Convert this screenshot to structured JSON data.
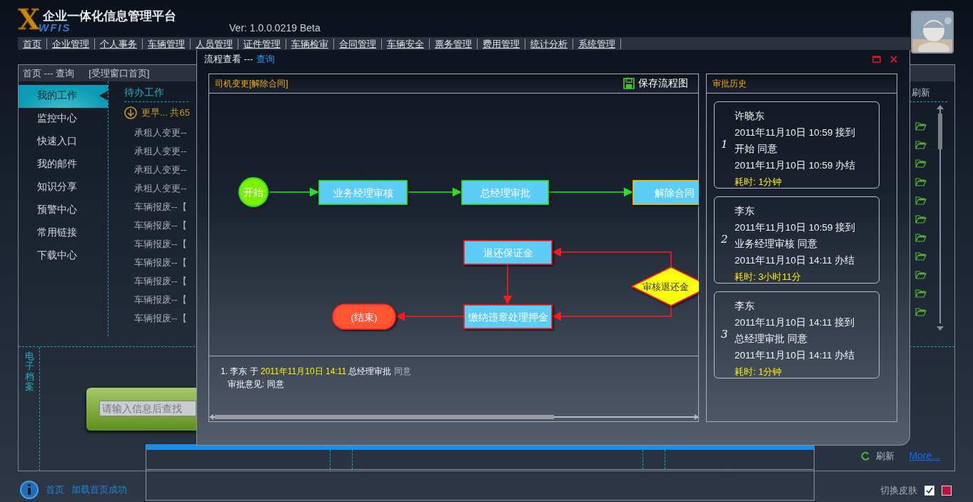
{
  "header": {
    "logo_letter": "X",
    "logo_text": "WFIS",
    "title": "企业一体化信息管理平台",
    "version": "Ver: 1.0.0.0219 Beta"
  },
  "menu": [
    {
      "label": "首页"
    },
    {
      "label": "企业管理"
    },
    {
      "label": "个人事务"
    },
    {
      "label": "车辆管理"
    },
    {
      "label": "人员管理"
    },
    {
      "label": "证件管理"
    },
    {
      "label": "车辆检审"
    },
    {
      "label": "合同管理"
    },
    {
      "label": "车辆安全"
    },
    {
      "label": "票务管理"
    },
    {
      "label": "费用管理"
    },
    {
      "label": "统计分析"
    },
    {
      "label": "系统管理"
    }
  ],
  "breadcrumb": {
    "path": "首页 --- 查询",
    "page": "[受理窗口首页]"
  },
  "sidebar": {
    "items": [
      {
        "label": "我的工作",
        "selected": true
      },
      {
        "label": "监控中心",
        "selected": false
      },
      {
        "label": "快速入口",
        "selected": false
      },
      {
        "label": "我的邮件",
        "selected": false
      },
      {
        "label": "知识分享",
        "selected": false
      },
      {
        "label": "预警中心",
        "selected": false
      },
      {
        "label": "常用链接",
        "selected": false
      },
      {
        "label": "下载中心",
        "selected": false
      }
    ]
  },
  "todo": {
    "title": "待办工作",
    "more": "更早... 共65",
    "refresh": "刷新",
    "items": [
      "承租人变更--",
      "承租人变更--",
      "承租人变更--",
      "承租人变更--",
      "车辆报废--【",
      "车辆报废--【",
      "车辆报废--【",
      "车辆报废--【",
      "车辆报废--【",
      "车辆报废--【",
      "车辆报废--【"
    ]
  },
  "archive": {
    "title": "电子档案",
    "search": {
      "placeholder": "请输入信息后查找"
    },
    "refresh": "刷新",
    "more": "More..."
  },
  "status_bar": {
    "home": "首页",
    "message": "加载首页成功",
    "skin_label": "切换皮肤",
    "skin_checked": true
  },
  "dialog": {
    "title": "流程查看 ---",
    "title_link": "查询",
    "flow": {
      "title": "司机变更[解除合同]",
      "save": "保存流程图",
      "nodes": [
        {
          "label": "开始",
          "kind": "start",
          "completed": true,
          "current": false
        },
        {
          "label": "业务经理审核",
          "kind": "task",
          "completed": true,
          "current": false
        },
        {
          "label": "总经理审批",
          "kind": "task",
          "completed": true,
          "current": false
        },
        {
          "label": "解除合同",
          "kind": "task",
          "completed": false,
          "current": true
        },
        {
          "label": "退还保证金",
          "kind": "task",
          "completed": false,
          "current": false
        },
        {
          "label": "审核退还金",
          "kind": "decision",
          "completed": false,
          "current": false
        },
        {
          "label": "(结束)",
          "kind": "end",
          "completed": false,
          "current": false
        },
        {
          "label": "缴纳违章处理押金",
          "kind": "task",
          "completed": false,
          "current": false
        }
      ],
      "comments": [
        {
          "who": "1. 李东 于",
          "time": "2011年11月10日 14:11",
          "step": "总经理审批",
          "result": "同意",
          "opinion": "审批意见: 同意"
        }
      ]
    },
    "history": {
      "title": "审批历史",
      "entries": [
        {
          "number": "1",
          "name": "许晓东",
          "received": "2011年11月10日 10:59",
          "received_label": "接到",
          "step": "开始",
          "result": "同意",
          "finished": "2011年11月10日 10:59",
          "finished_label": "办结",
          "duration": "耗时: 1分钟"
        },
        {
          "number": "2",
          "name": "李东",
          "received": "2011年11月10日 10:59",
          "received_label": "接到",
          "step": "业务经理审核",
          "result": "同意",
          "finished": "2011年11月10日 14:11",
          "finished_label": "办结",
          "duration": "耗时: 3小时11分"
        },
        {
          "number": "3",
          "name": "李东",
          "received": "2011年11月10日 14:11",
          "received_label": "接到",
          "step": "总经理审批",
          "result": "同意",
          "finished": "2011年11月10日 14:11",
          "finished_label": "办结",
          "duration": "耗时: 1分钟"
        }
      ]
    }
  }
}
